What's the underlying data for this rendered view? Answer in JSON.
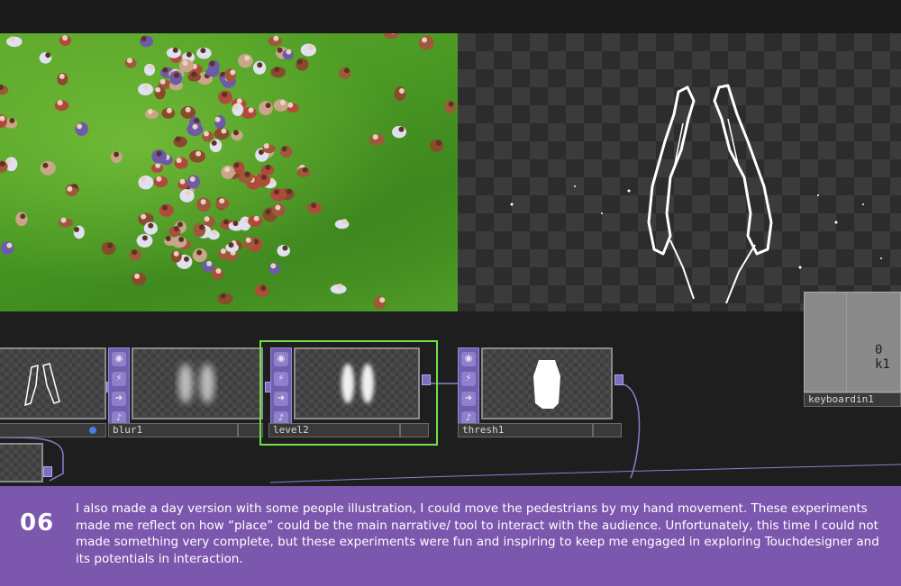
{
  "network": {
    "nodes": [
      {
        "name": "blur1"
      },
      {
        "name": "level2"
      },
      {
        "name": "thresh1"
      },
      {
        "name": "keyboardin1",
        "value": "0 k1"
      }
    ]
  },
  "caption": {
    "number": "06",
    "text": "I also made a day version with some people illustration, I could move the pedestrians by my hand movement. These experiments made me reflect on how “place” could be the main narrative/ tool to interact with the audience. Unfortunately, this time I could not made something very complete, but these experiments were fun and inspiring to keep me engaged in exploring Touchdesigner and its potentials in interaction."
  },
  "colors": {
    "caption_bg": "#7b57ad",
    "selection": "#6fe04a",
    "node_toolbar": "#6f5fae",
    "grass": "#4b9a24"
  },
  "icons": [
    "viewer-icon",
    "bypass-icon",
    "export-icon",
    "cook-icon"
  ]
}
